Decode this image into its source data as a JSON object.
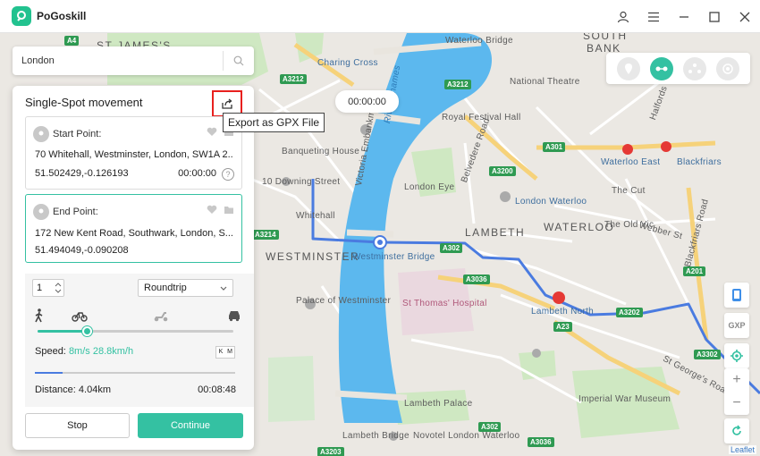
{
  "app": {
    "name": "PoGoskill"
  },
  "search": {
    "value": "London"
  },
  "panel": {
    "title": "Single-Spot movement",
    "export_tooltip": "Export as GPX File",
    "start": {
      "label": "Start Point:",
      "address": "70 Whitehall, Westminster, London, SW1A 2...",
      "coords": "51.502429,-0.126193",
      "time": "00:00:00"
    },
    "end": {
      "label": "End Point:",
      "address": "172 New Kent Road, Southwark, London, S...",
      "coords": "51.494049,-0.090208"
    },
    "repeat_count": "1",
    "mode": "Roundtrip",
    "speed_label": "Speed:",
    "speed_value": "8m/s 28.8km/h",
    "unit_k": "K",
    "unit_m": "M",
    "distance_label": "Distance:",
    "distance_value": "4.04km",
    "duration": "00:08:48",
    "stop_label": "Stop",
    "continue_label": "Continue",
    "speed_fraction": 0.25,
    "progress_fraction": 0.14
  },
  "timer": "00:00:00",
  "side_tools": {
    "gxp": "GXP"
  },
  "attribution": "Leaflet",
  "map": {
    "labels": [
      {
        "t": "ST JAMES'S"
      },
      {
        "t": "SOUTH"
      },
      {
        "t": "BANK"
      },
      {
        "t": "Waterloo Bridge"
      },
      {
        "t": "Charing Cross"
      },
      {
        "t": "National Theatre"
      },
      {
        "t": "Royal Festival Hall"
      },
      {
        "t": "Banqueting House"
      },
      {
        "t": "10 Downing Street"
      },
      {
        "t": "London Eye"
      },
      {
        "t": "Waterloo East"
      },
      {
        "t": "Blackfriars"
      },
      {
        "t": "London Waterloo"
      },
      {
        "t": "The Cut"
      },
      {
        "t": "LAMBETH"
      },
      {
        "t": "WATERLOO"
      },
      {
        "t": "The Old Vic"
      },
      {
        "t": "Whitehall"
      },
      {
        "t": "WESTMINSTER"
      },
      {
        "t": "Westminster Bridge"
      },
      {
        "t": "Palace of Westminster"
      },
      {
        "t": "St Thomas' Hospital"
      },
      {
        "t": "Lambeth North"
      },
      {
        "t": "Imperial War Museum"
      },
      {
        "t": "Lambeth Palace"
      },
      {
        "t": "Lambeth Bridge"
      },
      {
        "t": "Novotel London Waterloo"
      },
      {
        "t": "River Thames"
      },
      {
        "t": "Victoria Embankment"
      },
      {
        "t": "Belvedere Road"
      },
      {
        "t": "Webber St"
      },
      {
        "t": "Blackfriars Road"
      },
      {
        "t": "St George's Road"
      },
      {
        "t": "Halfords"
      }
    ],
    "roads": [
      "A4",
      "A3212",
      "A302",
      "A23",
      "A3036",
      "A3200",
      "A301",
      "A201",
      "A3202",
      "A3302",
      "A3214",
      "A302",
      "A3203",
      "A3212",
      "A3036"
    ]
  }
}
